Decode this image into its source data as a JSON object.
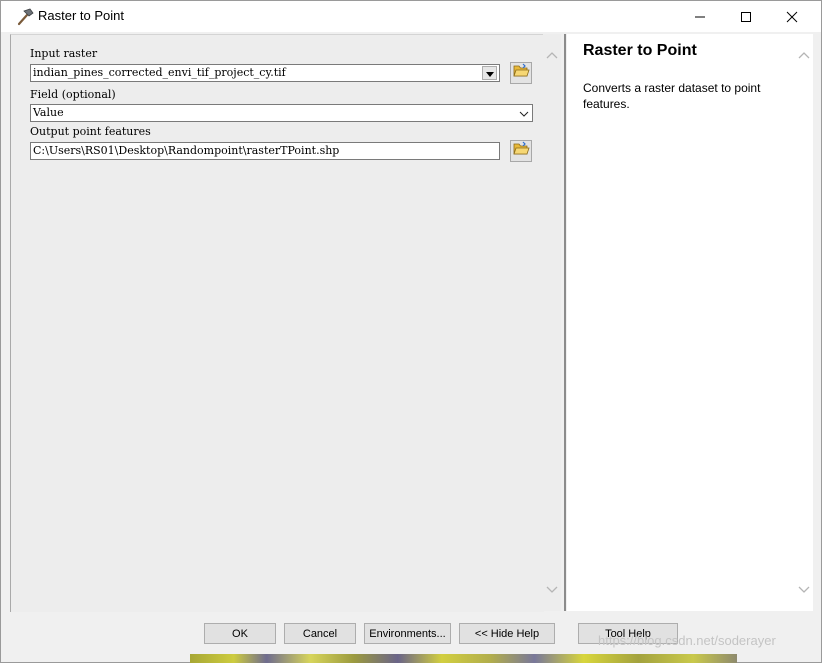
{
  "window": {
    "title": "Raster to Point",
    "minimize_icon": "minimize-icon",
    "maximize_icon": "maximize-icon",
    "close_icon": "close-icon"
  },
  "form": {
    "input_raster": {
      "label": "Input raster",
      "value": "indian_pines_corrected_envi_tif_project_cy.tif"
    },
    "field": {
      "label": "Field (optional)",
      "value": "Value"
    },
    "output": {
      "label": "Output point features",
      "value": "C:\\Users\\RS01\\Desktop\\Randompoint\\rasterTPoint.shp"
    }
  },
  "help": {
    "title": "Raster to Point",
    "description": "Converts a raster dataset to point features."
  },
  "buttons": {
    "ok": "OK",
    "cancel": "Cancel",
    "environments": "Environments...",
    "hide_help": "<< Hide Help",
    "tool_help": "Tool Help"
  },
  "watermark": "https://blog.csdn.net/soderayer",
  "colors": {
    "accent_folder": "#e8b93a",
    "help_background": "#ffffff",
    "dialog_background": "#f0f0f0"
  }
}
